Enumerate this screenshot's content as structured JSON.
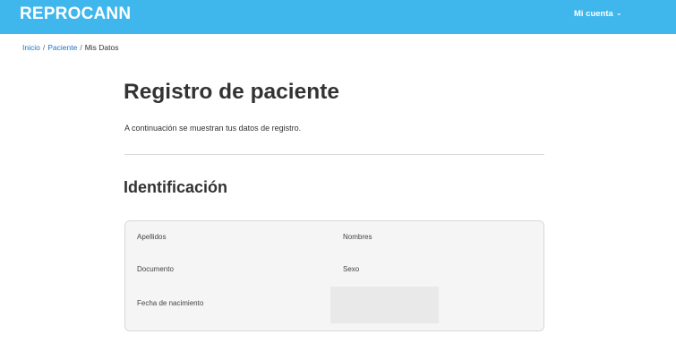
{
  "header": {
    "brand": "REPROCANN",
    "account_label": "Mi cuenta",
    "account_icon": "chevron-down-icon"
  },
  "breadcrumb": {
    "items": [
      "Inicio",
      "Paciente",
      "Mis Datos"
    ],
    "separator": "/"
  },
  "main": {
    "title": "Registro de paciente",
    "intro": "A continuación se muestran tus datos de registro.",
    "section_title": "Identificación",
    "fields": {
      "apellidos_label": "Apellidos",
      "nombres_label": "Nombres",
      "documento_label": "Documento",
      "sexo_label": "Sexo",
      "fecha_nacimiento_label": "Fecha de nacimiento"
    }
  },
  "colors": {
    "header_bg": "#3fb6ec",
    "link": "#1a74c9",
    "card_bg": "#f5f5f5"
  }
}
